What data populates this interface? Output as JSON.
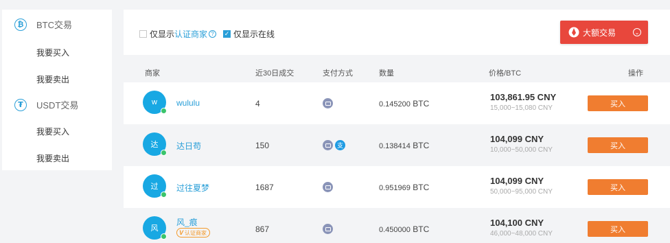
{
  "sidebar": {
    "groups": [
      {
        "icon": "bitcoin-icon",
        "symbol": "₿",
        "label": "BTC交易",
        "items": [
          "我要买入",
          "我要卖出"
        ]
      },
      {
        "icon": "tether-icon",
        "symbol": "₮",
        "label": "USDT交易",
        "items": [
          "我要买入",
          "我要卖出"
        ]
      }
    ]
  },
  "filters": {
    "verified_prefix": "仅显示",
    "verified_link": "认证商家",
    "verified_checked": false,
    "online_label": "仅显示在线",
    "online_checked": true,
    "big_trade_label": "大额交易"
  },
  "table": {
    "headers": {
      "merchant": "商家",
      "volume": "近30日成交",
      "payment": "支付方式",
      "quantity": "数量",
      "price": "价格/BTC",
      "action": "操作"
    },
    "rows": [
      {
        "avatar": "w",
        "name": "wululu",
        "verified": false,
        "volume": "4",
        "payments": [
          "bank-card"
        ],
        "qty": "0.145200",
        "unit": "BTC",
        "price": "103,861.95 CNY",
        "limit": "15,000~15,080 CNY",
        "action": "买入"
      },
      {
        "avatar": "达",
        "name": "达日苟",
        "verified": false,
        "volume": "150",
        "payments": [
          "bank-card",
          "alipay"
        ],
        "qty": "0.138414",
        "unit": "BTC",
        "price": "104,099 CNY",
        "limit": "10,000~50,000 CNY",
        "action": "买入"
      },
      {
        "avatar": "过",
        "name": "过往夏梦",
        "verified": false,
        "volume": "1687",
        "payments": [
          "bank-card"
        ],
        "qty": "0.951969",
        "unit": "BTC",
        "price": "104,099 CNY",
        "limit": "50,000~95,000 CNY",
        "action": "买入"
      },
      {
        "avatar": "风",
        "name": "风_痕",
        "verified": true,
        "badge_v": "V",
        "badge_text": "认证商家",
        "volume": "867",
        "payments": [
          "bank-card"
        ],
        "qty": "0.450000",
        "unit": "BTC",
        "price": "104,100 CNY",
        "limit": "46,000~48,000 CNY",
        "action": "买入"
      }
    ]
  },
  "colors": {
    "accent": "#2a9fd8",
    "big_trade_bg": "#e8473c",
    "buy_button_bg": "#f07d30",
    "online": "#3ac46b",
    "avatar_bg": "#18a8e3"
  }
}
